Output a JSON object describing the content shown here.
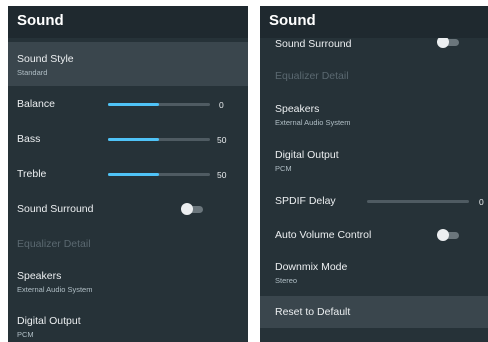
{
  "left": {
    "title": "Sound",
    "sound_style": {
      "label": "Sound Style",
      "value": "Standard"
    },
    "balance": {
      "label": "Balance",
      "value": "0",
      "level": 0.5
    },
    "bass": {
      "label": "Bass",
      "value": "50",
      "level": 0.5
    },
    "treble": {
      "label": "Treble",
      "value": "50",
      "level": 0.5
    },
    "sound_surround": {
      "label": "Sound Surround",
      "enabled": false
    },
    "equalizer": {
      "label": "Equalizer Detail"
    },
    "speakers": {
      "label": "Speakers",
      "value": "External Audio System"
    },
    "digital_output": {
      "label": "Digital Output",
      "value": "PCM"
    }
  },
  "right": {
    "title": "Sound",
    "sound_surround": {
      "label": "Sound Surround",
      "enabled": false
    },
    "equalizer": {
      "label": "Equalizer Detail"
    },
    "speakers": {
      "label": "Speakers",
      "value": "External Audio System"
    },
    "digital_output": {
      "label": "Digital Output",
      "value": "PCM"
    },
    "spdif_delay": {
      "label": "SPDIF Delay",
      "value": "0",
      "level": 0
    },
    "auto_volume": {
      "label": "Auto Volume Control",
      "enabled": false
    },
    "downmix": {
      "label": "Downmix Mode",
      "value": "Stereo"
    },
    "reset": {
      "label": "Reset to Default"
    }
  },
  "colors": {
    "panel_bg": "#263238",
    "header_bg": "#1f292f",
    "selected_bg": "#3a464d",
    "accent": "#4fc3f7"
  }
}
